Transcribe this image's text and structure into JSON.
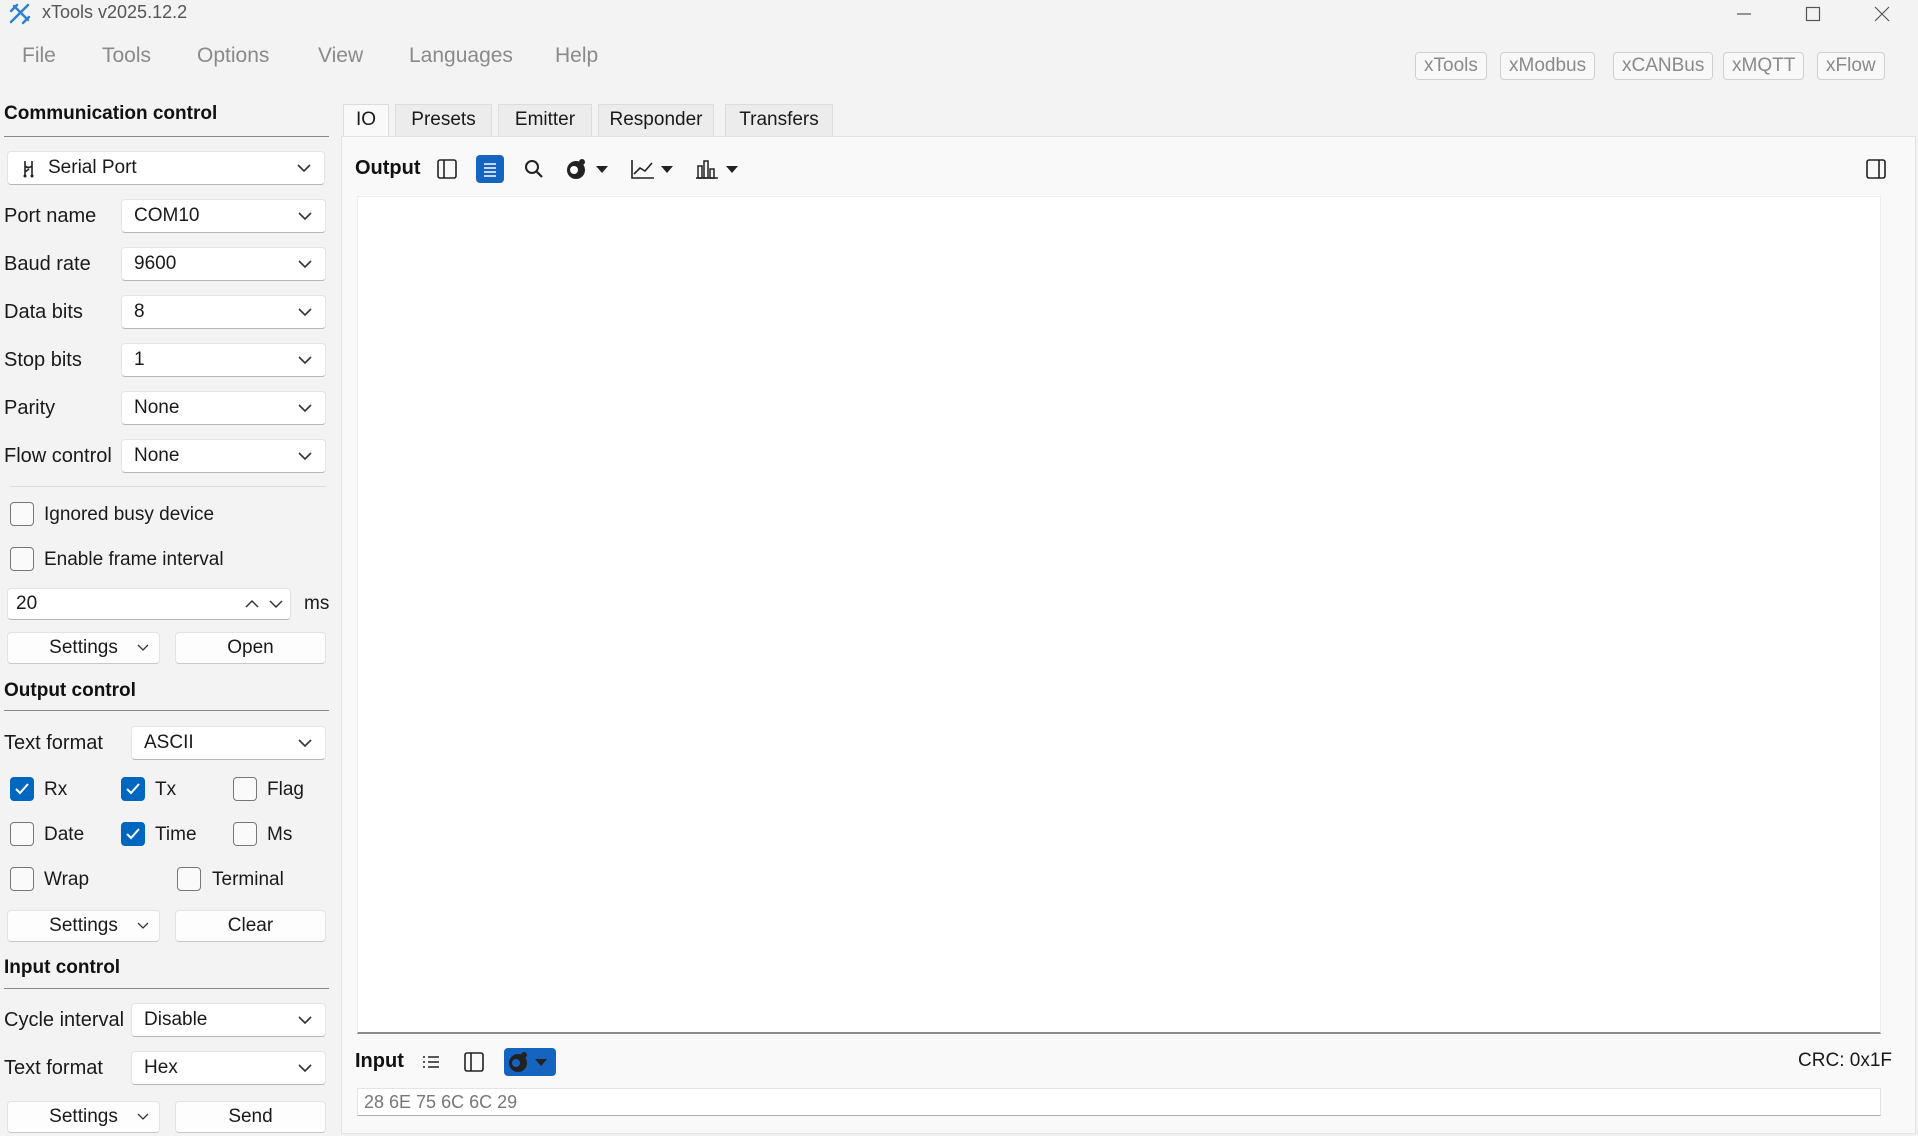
{
  "window": {
    "title": "xTools v2025.12.2"
  },
  "menu": [
    "File",
    "Tools",
    "Options",
    "View",
    "Languages",
    "Help"
  ],
  "quick_tools": [
    "xTools",
    "xModbus",
    "xCANBus",
    "xMQTT",
    "xFlow"
  ],
  "communication_control": {
    "title": "Communication control",
    "device_type": "Serial Port",
    "fields": [
      {
        "label": "Port name",
        "value": "COM10"
      },
      {
        "label": "Baud rate",
        "value": "9600"
      },
      {
        "label": "Data bits",
        "value": "8"
      },
      {
        "label": "Stop bits",
        "value": "1"
      },
      {
        "label": "Parity",
        "value": "None"
      },
      {
        "label": "Flow control",
        "value": "None"
      }
    ],
    "ignored_busy_device": {
      "label": "Ignored busy device",
      "checked": false
    },
    "enable_frame_interval": {
      "label": "Enable frame interval",
      "checked": false
    },
    "frame_interval": {
      "value": "20",
      "unit": "ms"
    },
    "settings_label": "Settings",
    "open_label": "Open"
  },
  "output_control": {
    "title": "Output control",
    "text_format_label": "Text format",
    "text_format_value": "ASCII",
    "options": [
      {
        "label": "Rx",
        "checked": true
      },
      {
        "label": "Tx",
        "checked": true
      },
      {
        "label": "Flag",
        "checked": false
      },
      {
        "label": "Date",
        "checked": false
      },
      {
        "label": "Time",
        "checked": true
      },
      {
        "label": "Ms",
        "checked": false
      },
      {
        "label": "Wrap",
        "checked": false
      },
      {
        "label": "Terminal",
        "checked": false
      }
    ],
    "settings_label": "Settings",
    "clear_label": "Clear"
  },
  "input_control": {
    "title": "Input control",
    "cycle_interval_label": "Cycle interval",
    "cycle_interval_value": "Disable",
    "text_format_label": "Text format",
    "text_format_value": "Hex",
    "settings_label": "Settings",
    "send_label": "Send"
  },
  "tabs": [
    "IO",
    "Presets",
    "Emitter",
    "Responder",
    "Transfers"
  ],
  "active_tab": "IO",
  "output": {
    "label": "Output"
  },
  "input": {
    "label": "Input",
    "value": "28 6E 75 6C 6C 29",
    "crc": "CRC: 0x1F"
  },
  "colors": {
    "accent": "#0067c0",
    "background": "#f3f3f3"
  }
}
